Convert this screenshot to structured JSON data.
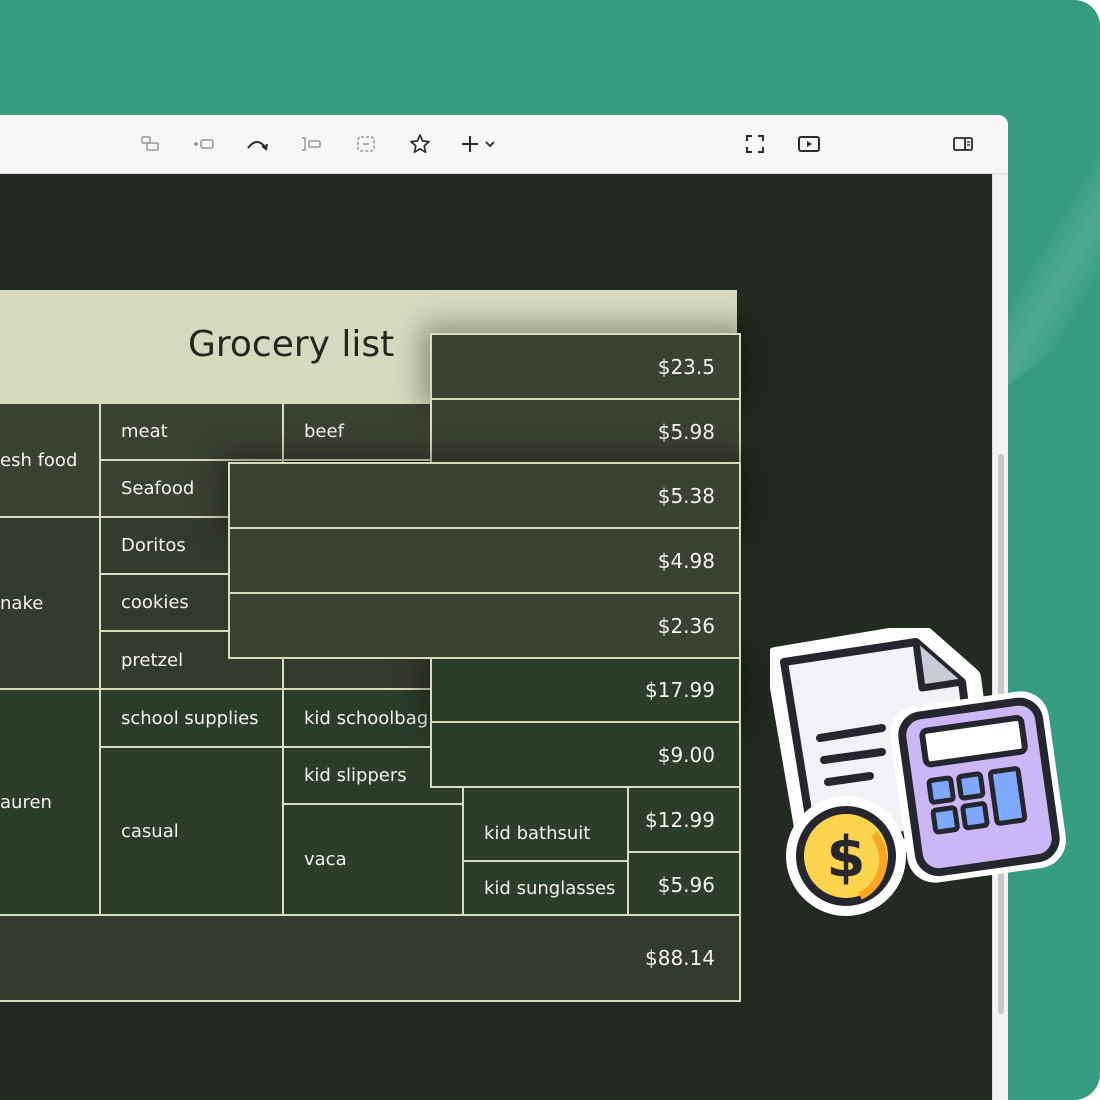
{
  "toolbar": {
    "buttons": [
      {
        "name": "arrange-icon"
      },
      {
        "name": "connect-icon"
      },
      {
        "name": "curve-icon"
      },
      {
        "name": "branch-icon"
      },
      {
        "name": "frame-icon"
      },
      {
        "name": "star-icon"
      },
      {
        "name": "add-menu-icon"
      },
      {
        "name": "fullscreen-icon"
      },
      {
        "name": "present-icon"
      },
      {
        "name": "panel-toggle-icon"
      }
    ]
  },
  "slide": {
    "title": "Grocery list",
    "categories": [
      "esh food",
      "nake",
      "auren"
    ],
    "subcategories": [
      "meat",
      "Seafood",
      "Doritos",
      "cookies",
      "pretzel",
      "school supplies",
      "casual"
    ],
    "items": [
      "beef",
      "kid schoolbag",
      "kid slippers",
      "vaca",
      "kid bathsuit",
      "kid sunglasses"
    ],
    "prices": [
      "$23.5",
      "$5.98",
      "$5.38",
      "$4.98",
      "$2.36",
      "$17.99",
      "$9.00",
      "$12.99",
      "$5.96"
    ],
    "total": "$88.14"
  },
  "colors": {
    "background": "#379d80",
    "canvas": "#222a21",
    "header": "#d6d9c0",
    "cell_olive": "#3c4232",
    "cell_green": "#2c3d2a",
    "border": "#d6dcc0"
  },
  "sticker": {
    "icons": [
      "receipt-icon",
      "calculator-icon",
      "dollar-coin-icon"
    ],
    "coin_symbol": "$"
  }
}
